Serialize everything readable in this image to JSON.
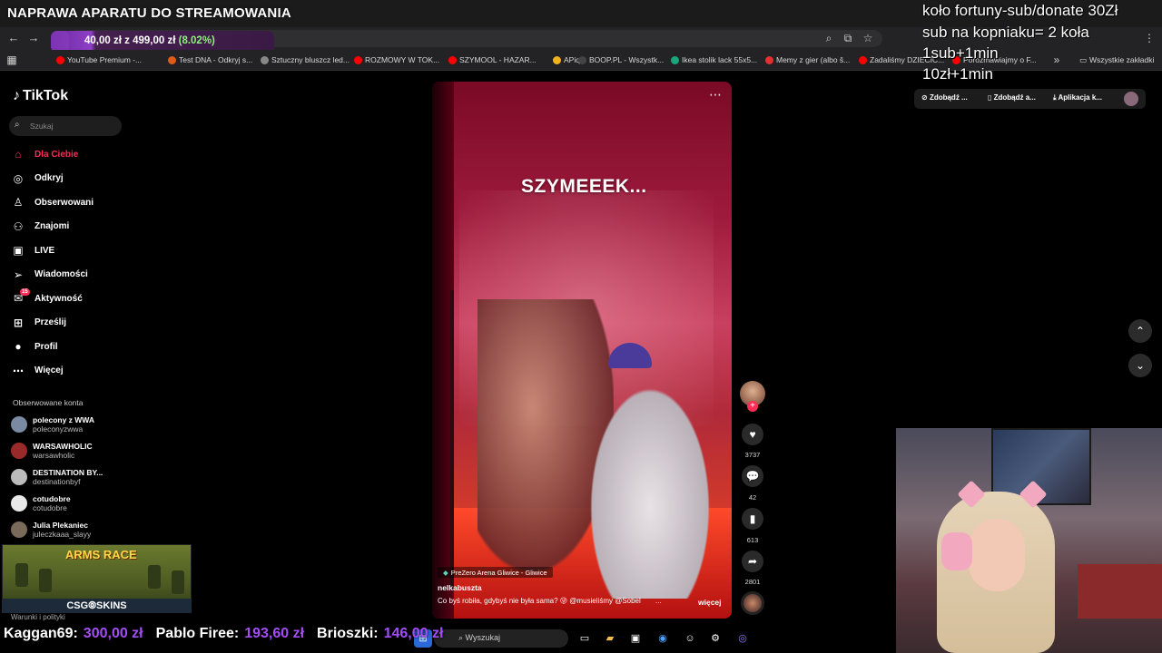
{
  "stream": {
    "title": "NAPRAWA APARATU DO STREAMOWANIA",
    "donation_goal": {
      "current": "40,00 zł",
      "separator": "z",
      "target": "499,00 zł",
      "percent_label": "(8.02%)",
      "progress": 0.0802
    }
  },
  "browser": {
    "icons": {
      "back": "arrow-left-icon",
      "forward": "arrow-right-icon",
      "reload": "reload-icon",
      "home": "home-icon"
    },
    "bookmarks": [
      {
        "label": "YouTube Premium -...",
        "color": "#ff0000"
      },
      {
        "label": "Test DNA - Odkryj s...",
        "color": "#e05a1a"
      },
      {
        "label": "Sztuczny bluszcz led...",
        "color": "#888888"
      },
      {
        "label": "ROZMOWY W TOK...",
        "color": "#ff0000"
      },
      {
        "label": "SZYMOOL - HAZAR...",
        "color": "#ff0000"
      },
      {
        "label": "APiq",
        "color": "#f2b31a"
      },
      {
        "label": "BOOP.PL - Wszystk...",
        "color": "#444444"
      },
      {
        "label": "Ikea stolik lack 55x5...",
        "color": "#1aa67a"
      },
      {
        "label": "Memy z gier (albo š...",
        "color": "#e03030"
      },
      {
        "label": "Zadaliśmy DZIECIC...",
        "color": "#ff0000"
      },
      {
        "label": "Porozmawiajmy o F...",
        "color": "#ff0000"
      }
    ],
    "all_bookmarks": "Wszystkie zakładki"
  },
  "tiktok": {
    "logo": "TikTok",
    "search_placeholder": "Szukaj",
    "nav": [
      {
        "label": "Dla Ciebie",
        "icon": "home-icon",
        "active": true
      },
      {
        "label": "Odkryj",
        "icon": "compass-icon",
        "active": false
      },
      {
        "label": "Obserwowani",
        "icon": "user-follow-icon",
        "active": false
      },
      {
        "label": "Znajomi",
        "icon": "friends-icon",
        "active": false
      },
      {
        "label": "LIVE",
        "icon": "live-tv-icon",
        "active": false
      },
      {
        "label": "Wiadomości",
        "icon": "send-icon",
        "active": false
      },
      {
        "label": "Aktywność",
        "icon": "inbox-icon",
        "active": false,
        "badge": "15"
      },
      {
        "label": "Prześlij",
        "icon": "upload-icon",
        "active": false
      },
      {
        "label": "Profil",
        "icon": "profile-avatar-icon",
        "active": false
      },
      {
        "label": "Więcej",
        "icon": "more-dots-icon",
        "active": false
      }
    ],
    "followed_title": "Obserwowane konta",
    "followed": [
      {
        "name": "polecony z WWA",
        "handle": "poleconyzwwa"
      },
      {
        "name": "WARSAWHOLIC",
        "handle": "warsawholic"
      },
      {
        "name": "DESTINATION BY...",
        "handle": "destinationbyf"
      },
      {
        "name": "cotudobre",
        "handle": "cotudobre"
      },
      {
        "name": "Julia Plekaniec",
        "handle": "juleczkaaa_slayy"
      }
    ],
    "terms": "Warunki i polityki",
    "video": {
      "overlay_caption": "SZYMEEEK...",
      "location": "PreZero Arena Gliwice - Gliwice",
      "author": "nelkabuszta",
      "description": "Co byś robiła, gdybyś nie była sama? 😜 @musieliśmy @Sobel",
      "ellipsis": "...",
      "more": "więcej",
      "likes": "3737",
      "comments": "42",
      "saves": "613",
      "shares": "2801"
    }
  },
  "right_panel": {
    "promos": [
      "Zdobądź ...",
      "Zdobądź a...",
      "Aplikacja k..."
    ],
    "overlay_lines": [
      "koło fortuny-sub/donate 30Zł",
      "sub na kopniaku= 2 koła",
      "1sub+1min",
      "10zł+1min"
    ]
  },
  "ad": {
    "title": "ARMS RACE",
    "footer": "CSG⦾SKINS"
  },
  "ticker": [
    {
      "who": "Kaggan69:",
      "amount": "300,00 zł"
    },
    {
      "who": "Pablo Firee:",
      "amount": "193,60 zł"
    },
    {
      "who": "Brioszki:",
      "amount": "146,00 zł"
    }
  ],
  "taskbar": {
    "search_placeholder": "Wyszukaj"
  },
  "colors": {
    "accent": "#fe2c55",
    "donation_purple": "#a34df7",
    "goal_green": "#8cf27a"
  }
}
